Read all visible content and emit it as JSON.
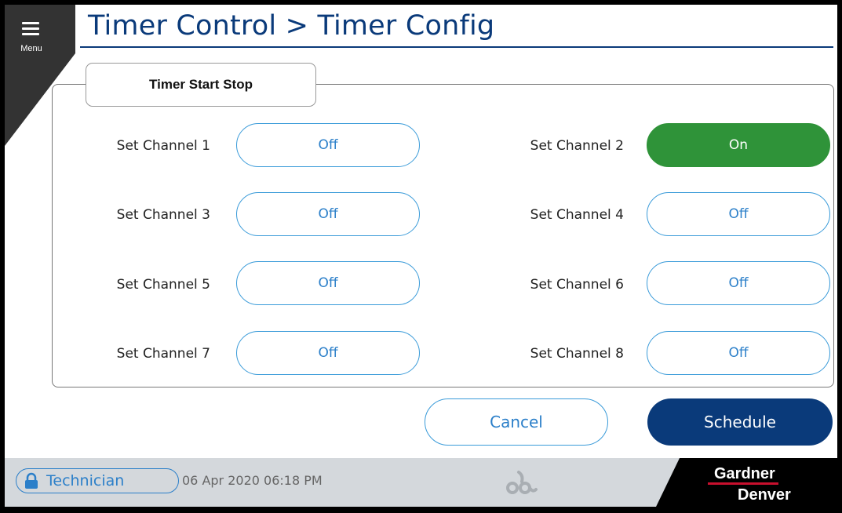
{
  "menu": {
    "label": "Menu",
    "icon": "hamburger-icon"
  },
  "title": "Timer Control > Timer Config",
  "panel": {
    "tab_label": "Timer Start Stop"
  },
  "channels": [
    {
      "label": "Set Channel 1",
      "value": "Off"
    },
    {
      "label": "Set Channel 2",
      "value": "On"
    },
    {
      "label": "Set Channel 3",
      "value": "Off"
    },
    {
      "label": "Set Channel 4",
      "value": "Off"
    },
    {
      "label": "Set Channel 5",
      "value": "Off"
    },
    {
      "label": "Set Channel 6",
      "value": "Off"
    },
    {
      "label": "Set Channel 7",
      "value": "Off"
    },
    {
      "label": "Set Channel 8",
      "value": "Off"
    }
  ],
  "actions": {
    "cancel": "Cancel",
    "schedule": "Schedule"
  },
  "footer": {
    "user": "Technician",
    "user_icon": "lock-icon",
    "datetime": "06 Apr 2020  06:18 PM",
    "brand_line1": "Gardner",
    "brand_line2": "Denver"
  },
  "colors": {
    "primary": "#0a3a7a",
    "accent": "#3a9bd9",
    "on": "#2f9339",
    "footer_bg": "#d4d8dc",
    "brand_red": "#c8102e"
  }
}
